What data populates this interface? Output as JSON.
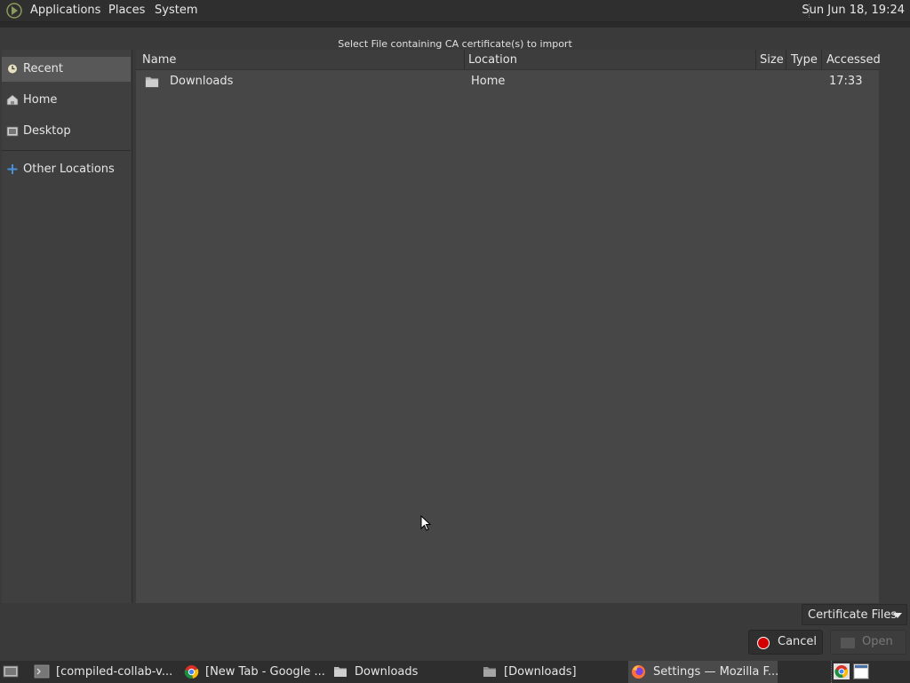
{
  "top_panel": {
    "menu": [
      "Applications",
      "Places",
      "System"
    ],
    "clock": "Sun Jun 18, 19:24"
  },
  "dialog": {
    "title": "Select File containing CA certificate(s) to import",
    "sidebar": {
      "items": [
        {
          "label": "Recent",
          "icon": "recent-icon",
          "selected": true
        },
        {
          "label": "Home",
          "icon": "home-icon",
          "selected": false
        },
        {
          "label": "Desktop",
          "icon": "desktop-icon",
          "selected": false
        },
        {
          "label": "Other Locations",
          "icon": "plus-icon",
          "selected": false
        }
      ]
    },
    "columns": [
      "Name",
      "Location",
      "Size",
      "Type",
      "Accessed"
    ],
    "rows": [
      {
        "name": "Downloads",
        "location": "Home",
        "size": "",
        "type": "",
        "accessed": "17:33",
        "icon": "folder-icon"
      }
    ],
    "filter": "Certificate Files",
    "buttons": {
      "cancel": "Cancel",
      "open": "Open"
    }
  },
  "taskbar": {
    "tasks": [
      {
        "label": "[compiled-collab-v...",
        "icon": "terminal-icon",
        "active": false
      },
      {
        "label": "[New Tab - Google ...",
        "icon": "chrome-icon",
        "active": false
      },
      {
        "label": "Downloads",
        "icon": "folder-icon",
        "active": false
      },
      {
        "label": "[Downloads]",
        "icon": "folder-icon",
        "active": false
      },
      {
        "label": "Settings — Mozilla F...",
        "icon": "firefox-icon",
        "active": true
      }
    ]
  },
  "colors": {
    "accent_cancel": "#d40000",
    "selection": "#585858"
  }
}
